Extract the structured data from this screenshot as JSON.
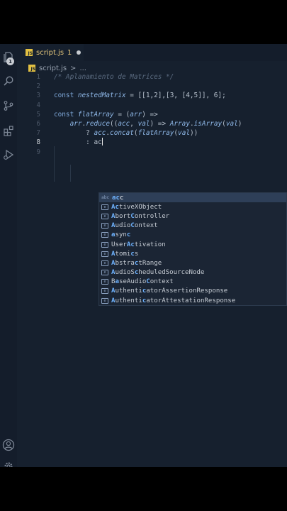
{
  "tab": {
    "filename": "script.js",
    "problems_count": "1",
    "file_type_label": "JS"
  },
  "activity_badge": "1",
  "breadcrumb": {
    "file": "script.js",
    "separator": ">",
    "symbol": "..."
  },
  "editor": {
    "lines": [
      {
        "num": "1",
        "tokens": [
          [
            "cm",
            "/* Aplanamiento de Matrices */"
          ]
        ]
      },
      {
        "num": "2",
        "tokens": []
      },
      {
        "num": "3",
        "tokens": [
          [
            "kw",
            "const "
          ],
          [
            "var",
            "nestedMatrix"
          ],
          [
            "pl",
            " = [[1,2],[3, [4,5]], 6];"
          ]
        ]
      },
      {
        "num": "4",
        "tokens": []
      },
      {
        "num": "5",
        "tokens": [
          [
            "kw",
            "const "
          ],
          [
            "var",
            "flatArray"
          ],
          [
            "pl",
            " = ("
          ],
          [
            "var",
            "arr"
          ],
          [
            "pl",
            ") =>"
          ]
        ]
      },
      {
        "num": "6",
        "tokens": [
          [
            "pl",
            "    "
          ],
          [
            "var",
            "arr"
          ],
          [
            "pl",
            "."
          ],
          [
            "fn",
            "reduce"
          ],
          [
            "pl",
            "(("
          ],
          [
            "var",
            "acc"
          ],
          [
            "pl",
            ", "
          ],
          [
            "var",
            "val"
          ],
          [
            "pl",
            ") => "
          ],
          [
            "fn",
            "Array"
          ],
          [
            "pl",
            "."
          ],
          [
            "fn",
            "isArray"
          ],
          [
            "pl",
            "("
          ],
          [
            "var",
            "val"
          ],
          [
            "pl",
            ")"
          ]
        ]
      },
      {
        "num": "7",
        "tokens": [
          [
            "pl",
            "        ? "
          ],
          [
            "var",
            "acc"
          ],
          [
            "pl",
            "."
          ],
          [
            "fn",
            "concat"
          ],
          [
            "pl",
            "("
          ],
          [
            "fn",
            "flatArray"
          ],
          [
            "pl",
            "("
          ],
          [
            "var",
            "val"
          ],
          [
            "pl",
            "))"
          ]
        ]
      },
      {
        "num": "8",
        "tokens": [
          [
            "pl",
            "        : ac"
          ]
        ]
      },
      {
        "num": "9",
        "tokens": []
      }
    ],
    "current_line": "8"
  },
  "suggestions": [
    {
      "icon": "abc",
      "label": "acc"
    },
    {
      "icon": "[e]",
      "label": "ActiveXObject"
    },
    {
      "icon": "[e]",
      "label": "AbortController"
    },
    {
      "icon": "[e]",
      "label": "AudioContext"
    },
    {
      "icon": "[e]",
      "label": "async"
    },
    {
      "icon": "[e]",
      "label": "UserActivation"
    },
    {
      "icon": "[e]",
      "label": "Atomics"
    },
    {
      "icon": "[e]",
      "label": "AbstractRange"
    },
    {
      "icon": "[e]",
      "label": "AudioScheduledSourceNode"
    },
    {
      "icon": "[e]",
      "label": "BaseAudioContext"
    },
    {
      "icon": "[e]",
      "label": "AuthenticatorAssertionResponse"
    },
    {
      "icon": "[e]",
      "label": "AuthenticatorAttestationResponse"
    }
  ],
  "colors": {
    "background": "#16202e",
    "accent_tab": "#e0c37a",
    "selection": "#2e3f58"
  }
}
